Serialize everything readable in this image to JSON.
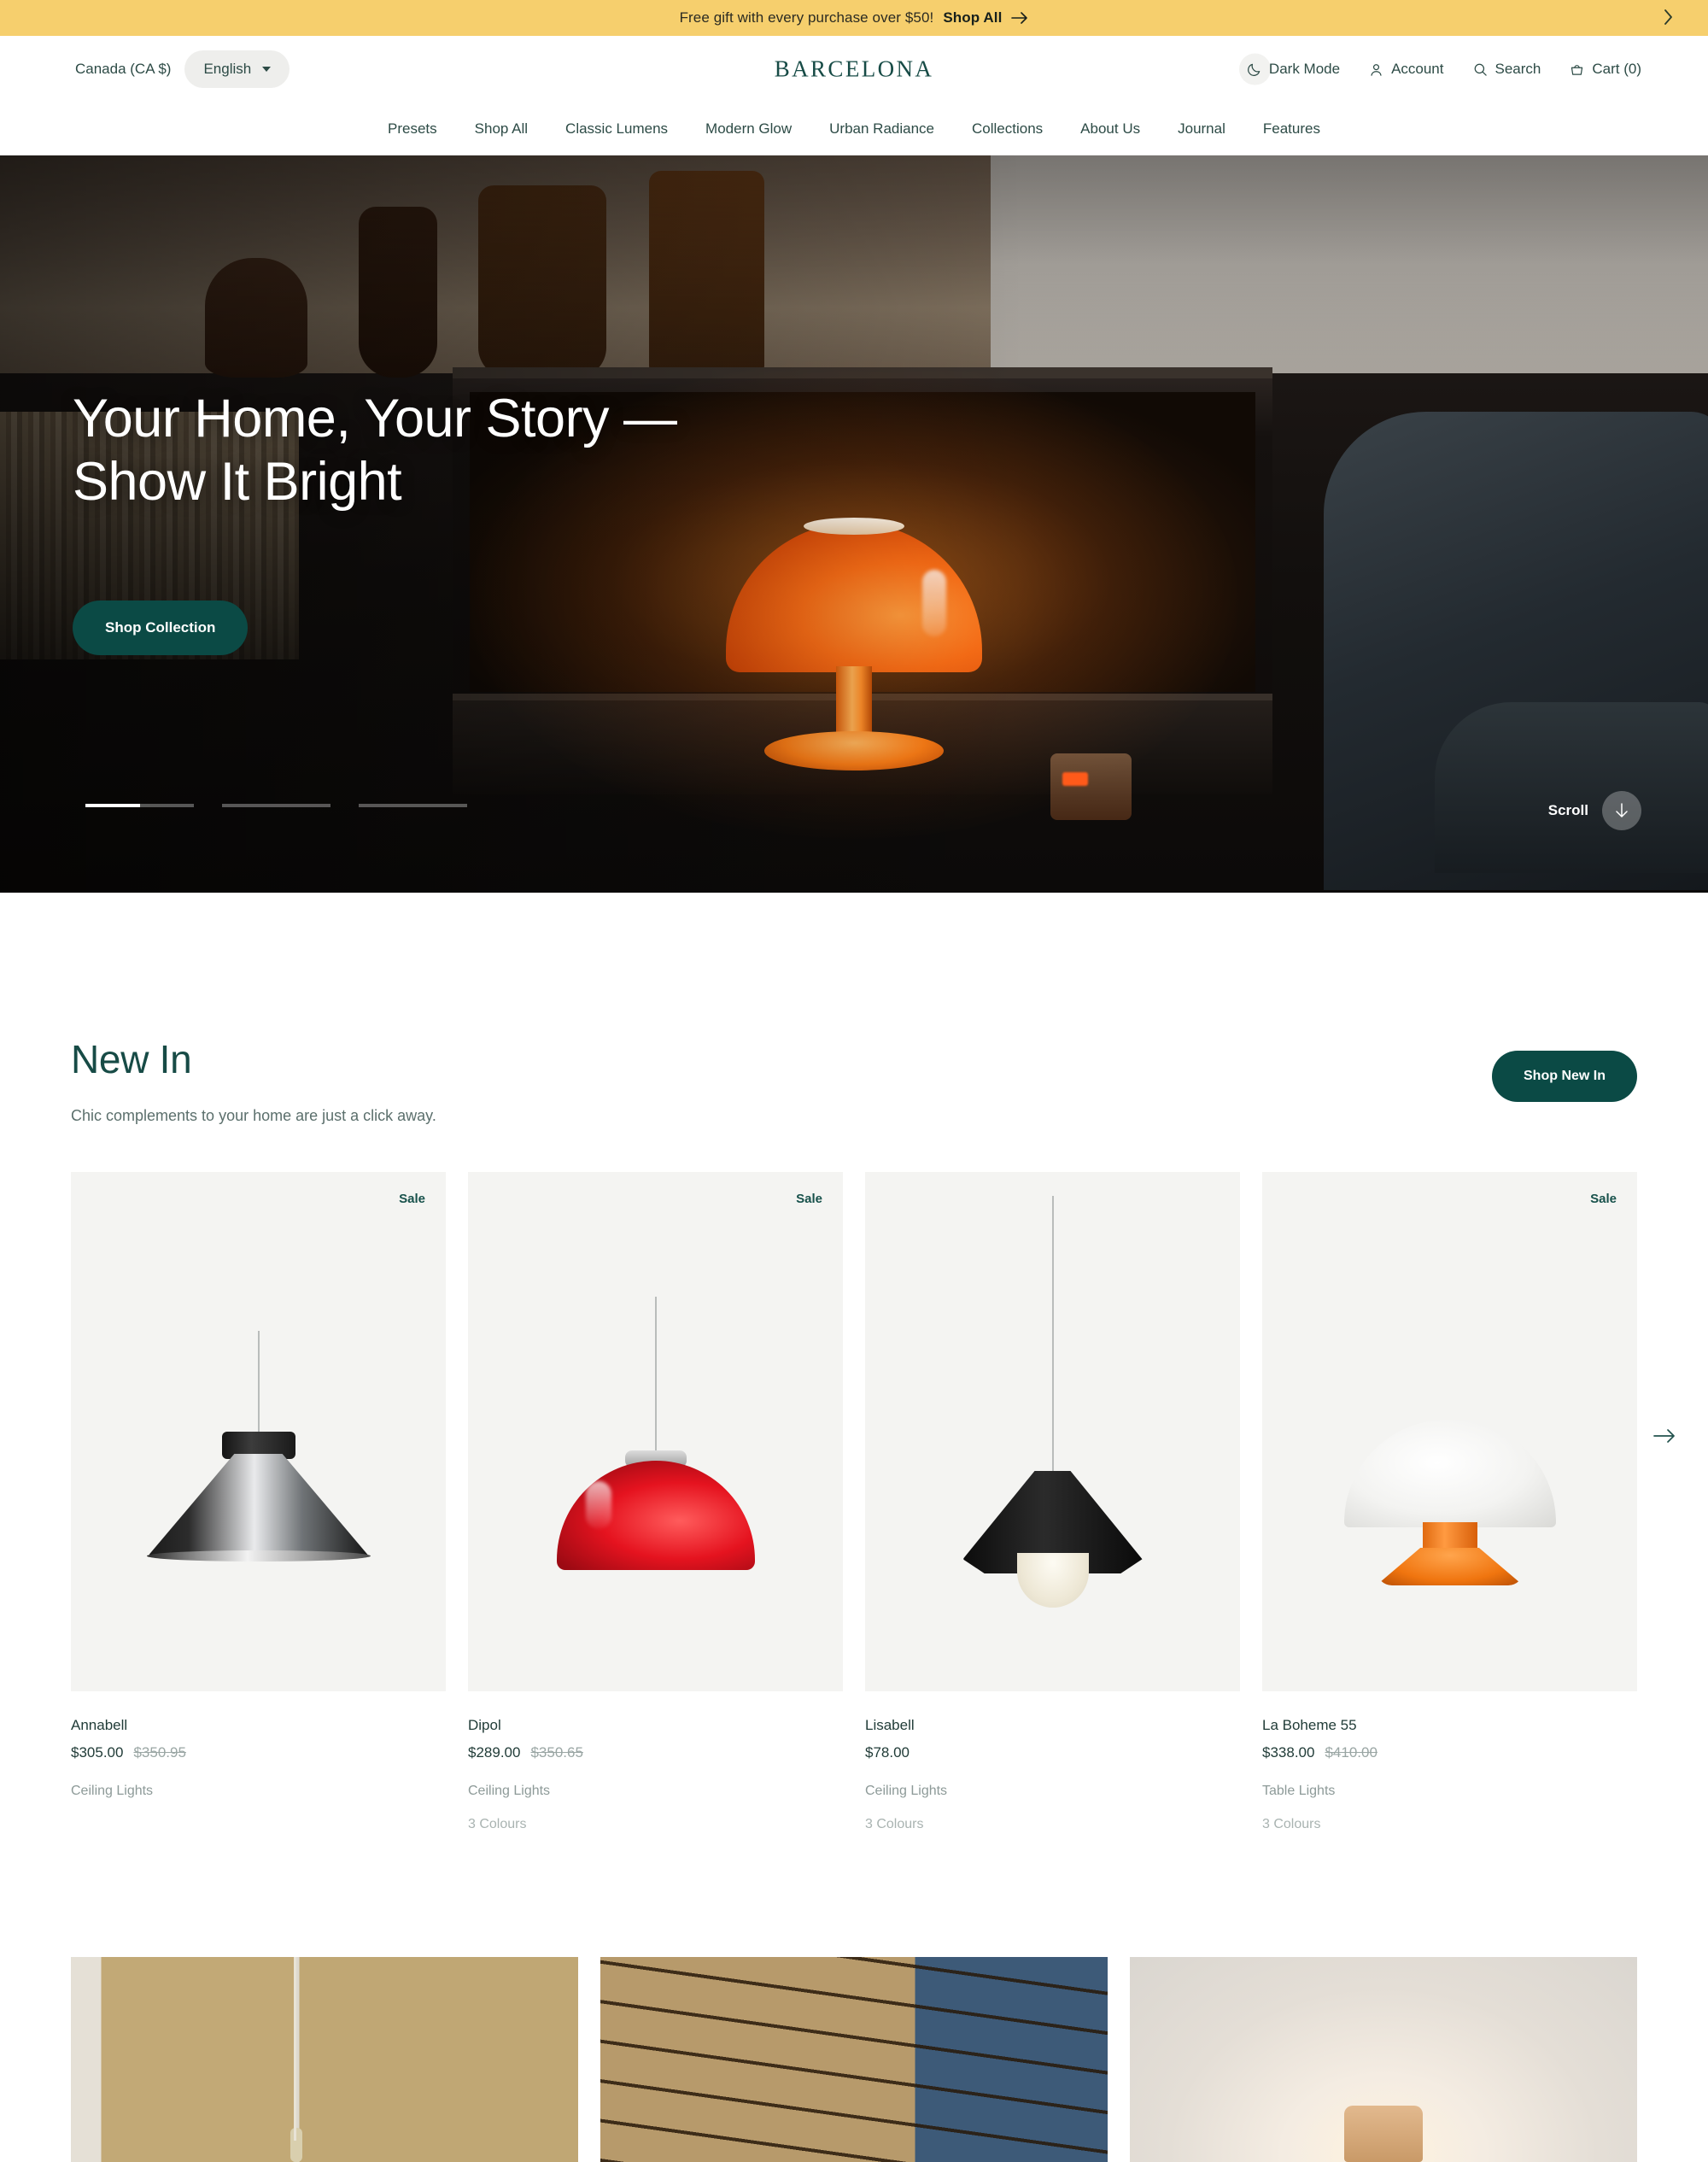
{
  "announcement": {
    "text": "Free gift with every purchase over $50!",
    "link_label": "Shop All",
    "arrow_icon": "arrow-right-icon",
    "next_icon": "chevron-right-icon"
  },
  "header": {
    "country": "Canada (CA $)",
    "language": "English",
    "brand": "BARCELONA",
    "actions": [
      {
        "label": "Dark Mode",
        "icon": "moon-icon"
      },
      {
        "label": "Account",
        "icon": "user-icon"
      },
      {
        "label": "Search",
        "icon": "search-icon"
      },
      {
        "label": "Cart (0)",
        "icon": "cart-icon"
      }
    ]
  },
  "nav": {
    "items": [
      {
        "label": "Presets"
      },
      {
        "label": "Shop All"
      },
      {
        "label": "Classic Lumens"
      },
      {
        "label": "Modern Glow"
      },
      {
        "label": "Urban Radiance"
      },
      {
        "label": "Collections"
      },
      {
        "label": "About Us"
      },
      {
        "label": "Journal"
      },
      {
        "label": "Features"
      }
    ]
  },
  "hero": {
    "title_line1": "Your Home, Your Story —",
    "title_line2": "Show It Bright",
    "cta_label": "Shop Collection",
    "scroll_label": "Scroll",
    "scroll_icon": "arrow-down-icon",
    "slides_total": 3,
    "active_slide": 1,
    "active_progress_percent": 50
  },
  "new_in": {
    "title": "New In",
    "subtitle": "Chic complements to your home are just a click away.",
    "cta_label": "Shop New In",
    "next_icon": "arrow-right-icon",
    "products": [
      {
        "name": "Annabell",
        "price": "$305.00",
        "compare_price": "$350.95",
        "category": "Ceiling Lights",
        "colours": "",
        "badge": "Sale"
      },
      {
        "name": "Dipol",
        "price": "$289.00",
        "compare_price": "$350.65",
        "category": "Ceiling Lights",
        "colours": "3 Colours",
        "badge": "Sale"
      },
      {
        "name": "Lisabell",
        "price": "$78.00",
        "compare_price": "",
        "category": "Ceiling Lights",
        "colours": "3 Colours",
        "badge": ""
      },
      {
        "name": "La Boheme 55",
        "price": "$338.00",
        "compare_price": "$410.00",
        "category": "Table Lights",
        "colours": "3 Colours",
        "badge": "Sale"
      }
    ]
  },
  "colors": {
    "announcement_bg": "#f6cf6d",
    "brand_teal": "#174b46",
    "button_teal": "#0b4a45",
    "card_bg": "#f4f4f2",
    "muted_text": "#8d9a98"
  }
}
